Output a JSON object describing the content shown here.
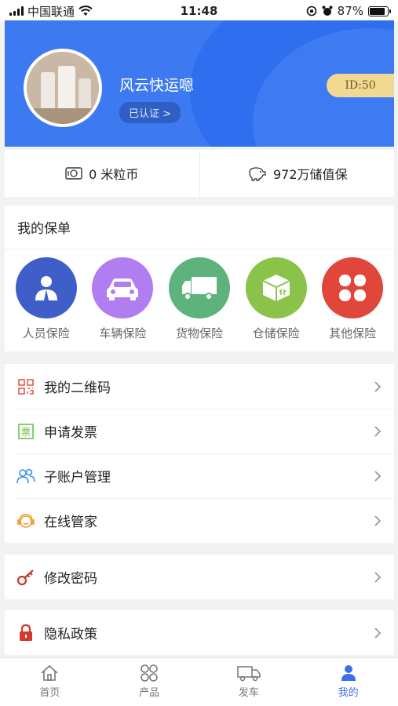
{
  "status_bar": {
    "carrier": "中国联通",
    "time": "11:48",
    "battery": "87%",
    "battery_level": 0.87
  },
  "profile": {
    "name": "风云快运嗯",
    "verified_label": "已认证 >",
    "id_label": "ID:50"
  },
  "stats": {
    "coins": "0 米粒币",
    "savings": "972万储值保"
  },
  "policies": {
    "title": "我的保单",
    "items": [
      {
        "label": "人员保险",
        "icon": "person-icon",
        "color": "#3f5ec8"
      },
      {
        "label": "车辆保险",
        "icon": "car-icon",
        "color": "#b07ef0"
      },
      {
        "label": "货物保险",
        "icon": "truck-icon",
        "color": "#5eb27b"
      },
      {
        "label": "仓储保险",
        "icon": "box-icon",
        "color": "#8bc34a"
      },
      {
        "label": "其他保险",
        "icon": "clover-icon",
        "color": "#e0463a"
      }
    ]
  },
  "menu_main": [
    {
      "label": "我的二维码",
      "icon": "qrcode-icon",
      "color": "#e05a4a"
    },
    {
      "label": "申请发票",
      "icon": "invoice-icon",
      "color": "#6cc24a"
    },
    {
      "label": "子账户管理",
      "icon": "users-icon",
      "color": "#3d8ef0"
    },
    {
      "label": "在线管家",
      "icon": "headset-icon",
      "color": "#f0a030"
    }
  ],
  "menu_password": {
    "label": "修改密码",
    "icon": "key-icon",
    "color": "#c33a2e"
  },
  "menu_privacy": {
    "label": "隐私政策",
    "icon": "lock-icon",
    "color": "#d23a2e"
  },
  "tabbar": [
    {
      "label": "首页",
      "icon": "home-icon"
    },
    {
      "label": "产品",
      "icon": "product-icon"
    },
    {
      "label": "发车",
      "icon": "truck-icon"
    },
    {
      "label": "我的",
      "icon": "profile-icon",
      "active": true
    }
  ],
  "colors": {
    "header_blue": "#3d7af2",
    "accent_blue": "#3d6fe6",
    "id_badge": "#f1d991"
  }
}
